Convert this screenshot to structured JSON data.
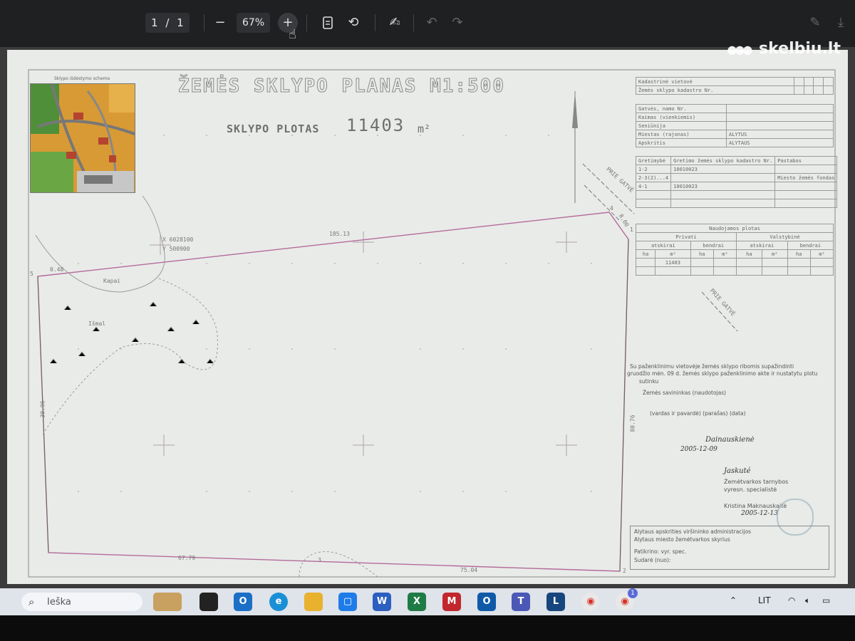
{
  "toolbar": {
    "page_current": "1",
    "page_separator": "/",
    "page_total": "1",
    "zoom": "67%",
    "zoom_out_icon": "minus-icon",
    "zoom_in_icon": "plus-icon",
    "fit_page_icon": "fit-page-icon",
    "rotate_icon": "rotate-icon",
    "draw_icon": "draw-icon",
    "undo_icon": "undo-icon",
    "redo_icon": "redo-icon",
    "annotate_icon": "annotate-icon",
    "download_icon": "download-icon"
  },
  "watermark": {
    "text": "skelbiu.lt"
  },
  "document": {
    "title": "ŽEMĖS SKLYPO PLANAS M1:500",
    "area_label": "SKLYPO PLOTAS",
    "area_value": "11403",
    "area_unit": "m²",
    "minimap_title": "Sklypo išdėstymo schema",
    "coord_x": "X 6028100",
    "coord_y": "Y 500900",
    "edge_top": "185.13",
    "edge_bottom_left": "67.79",
    "edge_bottom_right": "75.04",
    "edge_left": "30.96",
    "edge_right": "80.76",
    "edge_small": "8.00",
    "edge_small_left": "0.48",
    "street_1": "PRIE GATVĖ",
    "street_2": "PRIE GATVĖ",
    "zone_1": "Kapai",
    "zone_2": "Išmal",
    "point_1": "1",
    "point_2": "2",
    "point_3": "3",
    "point_4": "4",
    "point_5": "5"
  },
  "info_table": {
    "row1": [
      "Kadastrinė vietovė",
      "",
      "",
      "",
      ""
    ],
    "row2": [
      "Žemės sklypo kadastro Nr.",
      "",
      "",
      "",
      ""
    ],
    "row3": [
      "Gatvės, namo Nr.",
      "",
      "",
      ""
    ],
    "row4": [
      "Kaimas (vienkiemis)",
      ""
    ],
    "row5": [
      "Seniūnija",
      ""
    ],
    "row6": [
      "Miestas (rajonas)",
      "ALYTUS"
    ],
    "row7": [
      "Apskritis",
      "ALYTAUS"
    ]
  },
  "neighbors_table": {
    "header": [
      "Gretimybė",
      "Gretimo žemės sklypo kadastro Nr.",
      "Pastabos"
    ],
    "rows": [
      [
        "1-2",
        "10010023",
        ""
      ],
      [
        "2-3(2)...4",
        "",
        "Miesto žemės fondas"
      ],
      [
        "4-1",
        "10010023",
        ""
      ]
    ]
  },
  "usage_table": {
    "title": "Naudojamos plotas",
    "col_private": "Privati",
    "col_state": "Valstybinė",
    "sub": [
      "atskirai",
      "bendrai",
      "atskirai",
      "bendrai"
    ],
    "units": [
      "ha",
      "m²",
      "ha",
      "m²",
      "ha",
      "m²",
      "ha",
      "m²"
    ],
    "value": "11403"
  },
  "certificate": {
    "line1": "Su paženklinimu vietovėje žemės sklypo ribomis supažindinti",
    "line2": "gruodžio mėn. 09 d. žemės sklypo paženklinimo akte ir nustatytu plotu",
    "line3": "sutinku",
    "line4": "Žemės savininkas (naudotojas)",
    "sign_fields": "(vardas ir pavardė)        (parašas)        (data)",
    "handwritten": "Dainauskienė",
    "handwritten_date": "2005-12-09",
    "spec_name": "Jaskuté",
    "spec_org": "Žemėtvarkos tarnybos",
    "spec_role": "vyresn. specialistė",
    "spec_full": "Kristina Maknauskaitė",
    "spec_date": "2005-12-13",
    "footer1": "Alytaus apskrities viršininko administracijos",
    "footer2": "Alytaus miesto žemėtvarkos skyrius",
    "footer3": "Patikrino: vyr. spec.",
    "footer4": "Sudarė (nuo):"
  },
  "taskbar": {
    "search_placeholder": "Ieška",
    "language": "LIT",
    "badge": "1"
  },
  "colors": {
    "toolbar_bg": "#1f2022",
    "paper_bg": "#e9ebe8",
    "boundary_line": "#b36b9a",
    "taskbar_bg": "#dfe3ea"
  }
}
